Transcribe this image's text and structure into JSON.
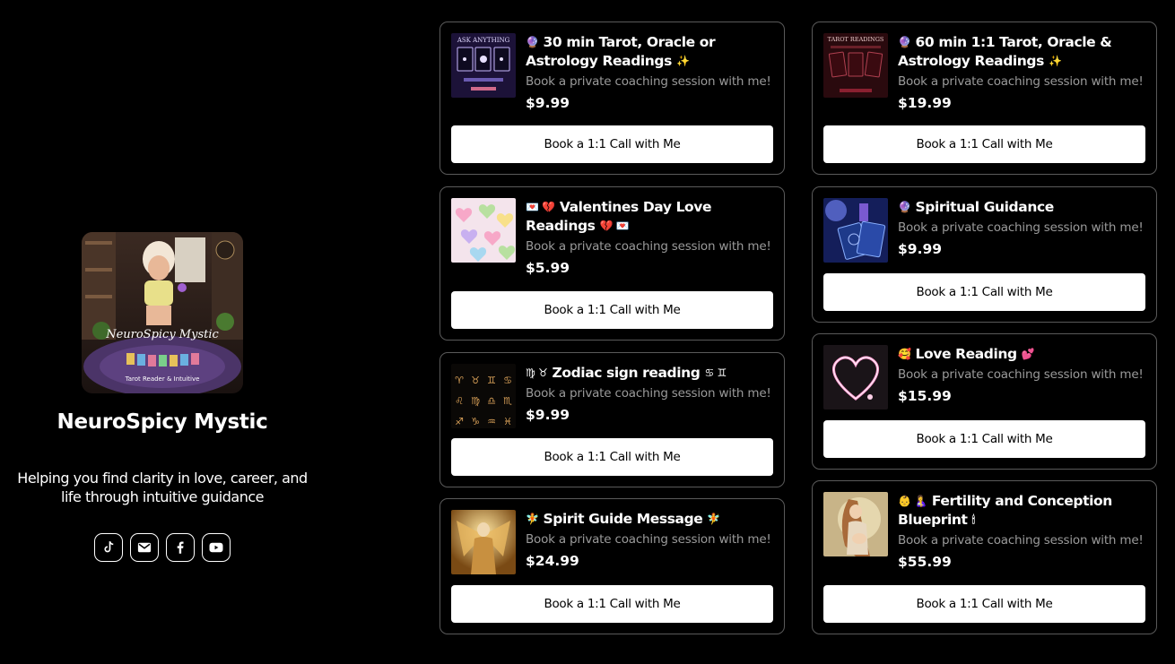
{
  "profile": {
    "name": "NeuroSpicy Mystic",
    "tagline": "Helping you find clarity in love, career, and life through intuitive guidance",
    "avatar_text": [
      "NeuroSpicy Mystic",
      "Tarot Reader & Intuitive"
    ],
    "socials": [
      {
        "name": "tiktok-icon",
        "label": "TikTok"
      },
      {
        "name": "email-icon",
        "label": "Email"
      },
      {
        "name": "facebook-icon",
        "label": "Facebook"
      },
      {
        "name": "youtube-icon",
        "label": "YouTube"
      }
    ]
  },
  "products": [
    {
      "id": "tarot-30",
      "title_prefix": "🔮",
      "title": "30 min Tarot, Oracle or Astrology Readings",
      "title_suffix": "✨",
      "description": "Book a private coaching session with me!",
      "price": "$9.99",
      "button": "Book a 1:1 Call with Me",
      "thumb_text": "ASK ANYTHING",
      "thumb": "cards-dark"
    },
    {
      "id": "tarot-60",
      "title_prefix": "🔮",
      "title": "60 min 1:1 Tarot, Oracle & Astrology Readings",
      "title_suffix": "✨",
      "description": "Book a private coaching session with me!",
      "price": "$19.99",
      "button": "Book a 1:1 Call with Me",
      "thumb_text": "TAROT READINGS",
      "thumb": "cards-red"
    },
    {
      "id": "valentines",
      "title_prefix": "💌 💔",
      "title": "Valentines Day Love Readings",
      "title_suffix": "💔 💌",
      "description": "Book a private coaching session with me!",
      "price": "$5.99",
      "button": "Book a 1:1 Call with Me",
      "thumb": "candy-hearts"
    },
    {
      "id": "spiritual-guidance",
      "title_prefix": "🔮",
      "title": "Spiritual Guidance",
      "title_suffix": "",
      "description": "Book a private coaching session with me!",
      "price": "$9.99",
      "button": "Book a 1:1 Call with Me",
      "thumb": "blue-cards"
    },
    {
      "id": "zodiac",
      "title_prefix": "♍ ♉",
      "title": "Zodiac sign reading",
      "title_suffix": "♋ ♊",
      "description": "Book a private coaching session with me!",
      "price": "$9.99",
      "button": "Book a 1:1 Call with Me",
      "thumb": "zodiac-grid"
    },
    {
      "id": "love-reading",
      "title_prefix": "🥰",
      "title": "Love Reading",
      "title_suffix": "💕",
      "description": "Book a private coaching session with me!",
      "price": "$15.99",
      "button": "Book a 1:1 Call with Me",
      "thumb": "sparkler-heart"
    },
    {
      "id": "spirit-guide",
      "title_prefix": "🧚",
      "title": "Spirit Guide Message",
      "title_suffix": "🧚",
      "description": "Book a private coaching session with me!",
      "price": "$24.99",
      "button": "Book a 1:1 Call with Me",
      "thumb": "golden-angel"
    },
    {
      "id": "fertility",
      "title_prefix": "👶 🤱",
      "title": "Fertility and Conception Blueprint",
      "title_suffix": "🕯",
      "description": "Book a private coaching session with me!",
      "price": "$55.99",
      "button": "Book a 1:1 Call with Me",
      "thumb": "mother-moon"
    }
  ],
  "colors": {
    "background": "#000000",
    "card_border": "#5a5a5a",
    "muted_text": "#9a9a9a",
    "button_bg": "#ffffff",
    "button_text": "#000000"
  }
}
